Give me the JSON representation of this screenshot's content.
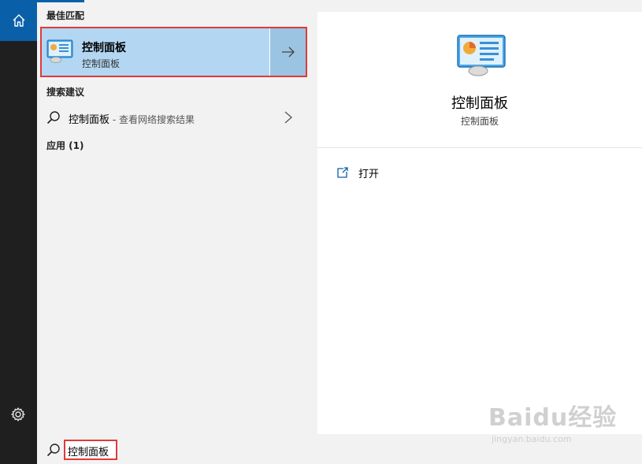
{
  "rail": {
    "home_icon": "home-icon",
    "settings_icon": "gear-icon"
  },
  "results": {
    "best_match_header": "最佳匹配",
    "best_match": {
      "title": "控制面板",
      "subtitle": "控制面板",
      "icon": "control-panel-icon"
    },
    "suggestions_header": "搜索建议",
    "suggestion": {
      "term": "控制面板",
      "hint": " - 查看网络搜索结果"
    },
    "apps_header": "应用 (1)"
  },
  "preview": {
    "title": "控制面板",
    "subtitle": "控制面板",
    "open_label": "打开"
  },
  "search": {
    "value": "控制面板"
  },
  "watermark": {
    "main": "Baidu经验",
    "sub": "jingyan.baidu.com"
  },
  "colors": {
    "accent": "#0a60a8",
    "highlight": "#b3d7f2",
    "annotation_red": "#e03a3a"
  }
}
